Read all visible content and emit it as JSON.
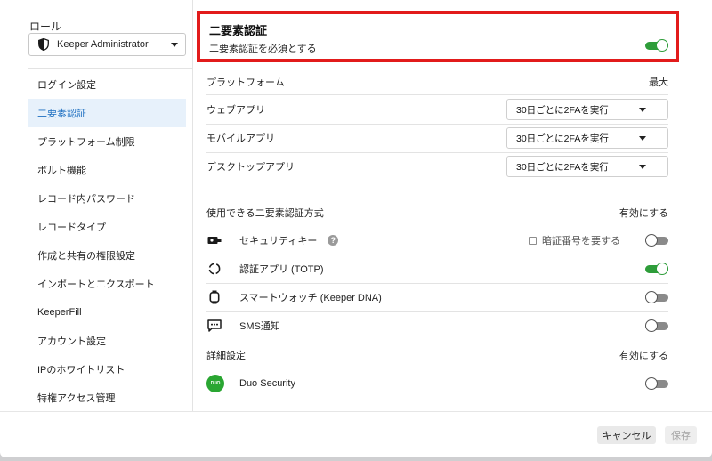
{
  "sidebar": {
    "role_label": "ロール",
    "role_value": "Keeper Administrator",
    "items": [
      {
        "label": "ログイン設定"
      },
      {
        "label": "二要素認証"
      },
      {
        "label": "プラットフォーム制限"
      },
      {
        "label": "ボルト機能"
      },
      {
        "label": "レコード内パスワード"
      },
      {
        "label": "レコードタイプ"
      },
      {
        "label": "作成と共有の権限設定"
      },
      {
        "label": "インポートとエクスポート"
      },
      {
        "label": "KeeperFill"
      },
      {
        "label": "アカウント設定"
      },
      {
        "label": "IPのホワイトリスト"
      },
      {
        "label": "特権アクセス管理"
      }
    ],
    "active_index": 1
  },
  "tfa": {
    "title": "二要素認証",
    "require_label": "二要素認証を必須とする",
    "require_enabled": true
  },
  "platforms": {
    "header": "プラットフォーム",
    "max_header": "最大",
    "rows": [
      {
        "label": "ウェブアプリ",
        "value": "30日ごとに2FAを実行"
      },
      {
        "label": "モバイルアプリ",
        "value": "30日ごとに2FAを実行"
      },
      {
        "label": "デスクトップアプリ",
        "value": "30日ごとに2FAを実行"
      }
    ]
  },
  "methods": {
    "header": "使用できる二要素認証方式",
    "enable_header": "有効にする",
    "rows": [
      {
        "label": "セキュリティキー",
        "icon": "security-key-icon",
        "enabled": false,
        "help": "?",
        "pin_label": "暗証番号を要する"
      },
      {
        "label": "認証アプリ (TOTP)",
        "icon": "authenticator-icon",
        "enabled": true
      },
      {
        "label": "スマートウォッチ (Keeper DNA)",
        "icon": "smartwatch-icon",
        "enabled": false
      },
      {
        "label": "SMS通知",
        "icon": "sms-icon",
        "enabled": false
      }
    ]
  },
  "advanced": {
    "header": "詳細設定",
    "enable_header": "有効にする",
    "rows": [
      {
        "label": "Duo Security",
        "icon": "duo-logo-icon",
        "icon_text": "DUO",
        "enabled": false
      }
    ]
  },
  "footer": {
    "cancel_label": "キャンセル",
    "save_label": "保存"
  },
  "colors": {
    "accent_green": "#2e9d3a",
    "highlight_red": "#e21b1b",
    "active_nav_bg": "#e7f1fb",
    "active_nav_text": "#1d6fc1"
  }
}
